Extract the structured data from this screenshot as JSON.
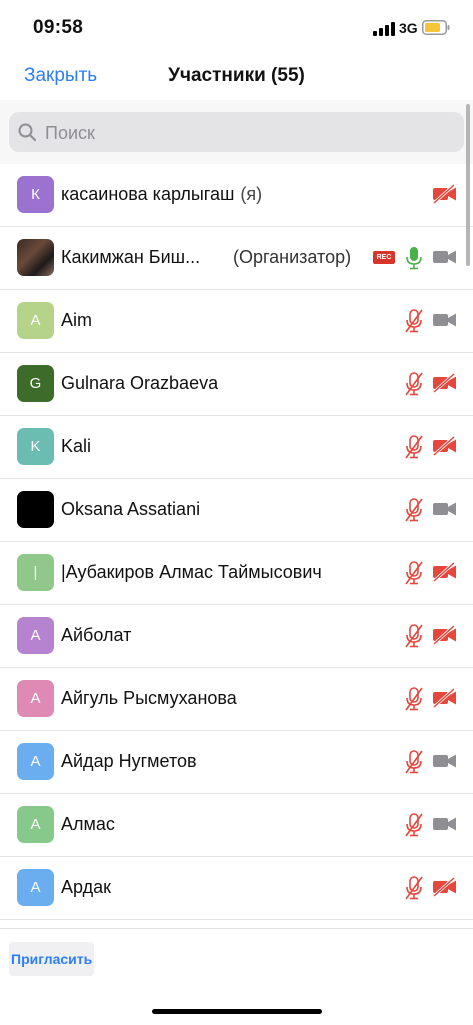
{
  "status_bar": {
    "time": "09:58",
    "network": "3G",
    "battery_color": "#f5c43a"
  },
  "nav": {
    "close_label": "Закрыть",
    "title": "Участники (55)"
  },
  "search": {
    "placeholder": "Поиск"
  },
  "colors": {
    "accent": "#2d7ef6",
    "muted_red": "#e5473d",
    "mic_on": "#4cb04a",
    "cam_gray": "#8e8e93"
  },
  "participants": [
    {
      "initial": "К",
      "avatar_color": "#9b72cf",
      "name": "касаинова карлыгаш",
      "suffix": "(я)",
      "mic": "none",
      "cam": "off"
    },
    {
      "initial": "",
      "avatar_color": "photo",
      "name": "Какимжан Биш...",
      "role": "(Организатор)",
      "rec": "REC",
      "mic": "on",
      "cam": "on"
    },
    {
      "initial": "A",
      "avatar_color": "#b5d48a",
      "name": "Aim",
      "mic": "off",
      "cam": "on"
    },
    {
      "initial": "G",
      "avatar_color": "#3d6b2a",
      "name": "Gulnara Orazbaeva",
      "mic": "off",
      "cam": "off"
    },
    {
      "initial": "K",
      "avatar_color": "#6bbdb2",
      "name": "Kali",
      "mic": "off",
      "cam": "off"
    },
    {
      "initial": "",
      "avatar_color": "#000000",
      "name": "Oksana Assatiani",
      "mic": "off",
      "cam": "on"
    },
    {
      "initial": "|",
      "avatar_color": "#8fc88a",
      "name": "|Аубакиров Алмас Таймысович",
      "mic": "off",
      "cam": "off"
    },
    {
      "initial": "А",
      "avatar_color": "#b683d0",
      "name": "Айболат",
      "mic": "off",
      "cam": "off"
    },
    {
      "initial": "А",
      "avatar_color": "#de8ab4",
      "name": "Айгуль Рысмуханова",
      "mic": "off",
      "cam": "off"
    },
    {
      "initial": "А",
      "avatar_color": "#6aaef0",
      "name": "Айдар Нугметов",
      "mic": "off",
      "cam": "on"
    },
    {
      "initial": "А",
      "avatar_color": "#86c98a",
      "name": "Алмас",
      "mic": "off",
      "cam": "on"
    },
    {
      "initial": "А",
      "avatar_color": "#6aaef0",
      "name": "Ардак",
      "mic": "off",
      "cam": "off"
    }
  ],
  "bottom": {
    "invite_label": "Пригласить"
  }
}
